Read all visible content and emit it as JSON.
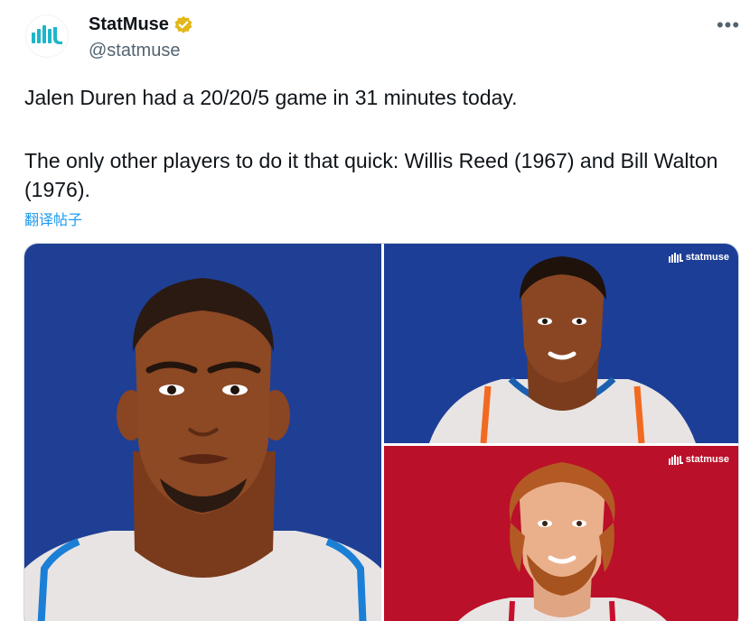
{
  "tweet": {
    "author_name": "StatMuse",
    "author_handle": "@statmuse",
    "text_line_1": "Jalen Duren had a 20/20/5 game in 31 minutes today.",
    "text_line_2": "The only other players to do it that quick: Willis Reed (1967) and Bill Walton (1976).",
    "translate_label": "翻译帖子",
    "more_label": "•••"
  },
  "media": {
    "watermark_top": "statmuse",
    "watermark_bottom": "statmuse"
  },
  "icons": {
    "avatar": "statmuse-logo-icon",
    "verified": "verified-badge-icon",
    "more": "more-options-icon"
  },
  "colors": {
    "brand_teal": "#1fb5c9",
    "verified_gold": "#e2b719",
    "link_blue": "#1d9bf0",
    "panel_blue": "#1e3f94",
    "panel_red": "#bb1029"
  }
}
